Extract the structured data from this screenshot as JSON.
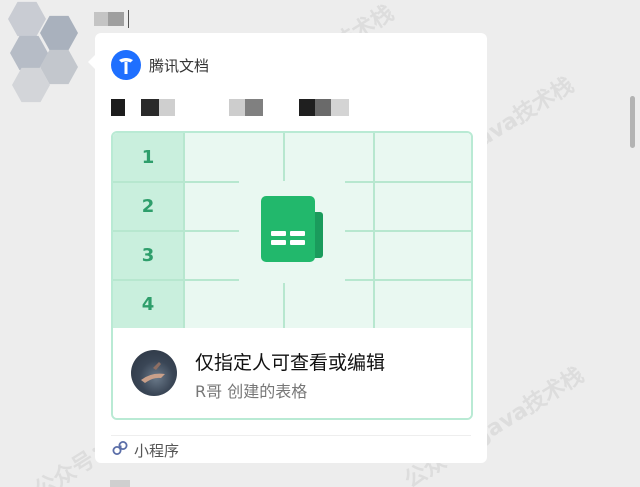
{
  "app": {
    "name": "腾讯文档"
  },
  "sheet_preview": {
    "row_numbers": [
      "1",
      "2",
      "3",
      "4"
    ]
  },
  "document": {
    "permission": "仅指定人可查看或编辑",
    "owner": "R哥 创建的表格"
  },
  "footer": {
    "label": "小程序"
  },
  "watermark": {
    "text": "公众号：Java技术栈"
  },
  "colors": {
    "background": "#ededed",
    "card": "#ffffff",
    "logo_blue": "#1e6fff",
    "sheet_green": "#21b06b",
    "grid_green": "#e9f8f1"
  }
}
